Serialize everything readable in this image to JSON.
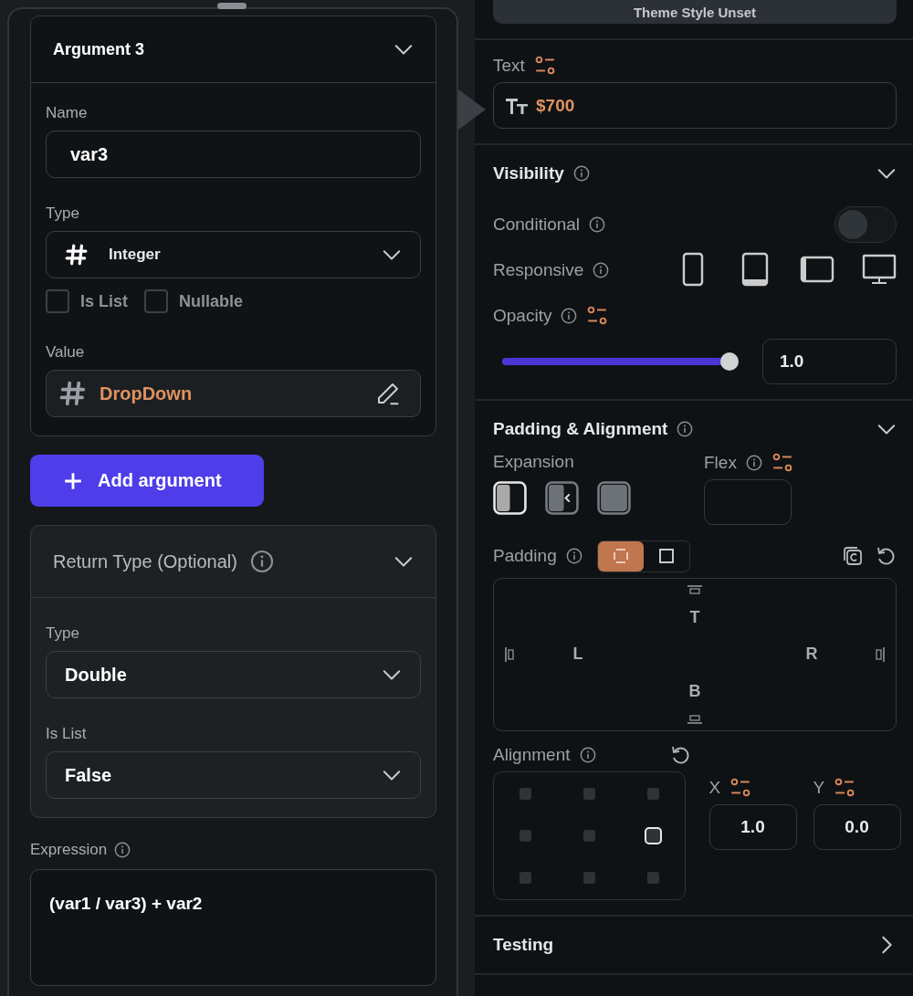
{
  "argument": {
    "title": "Argument 3",
    "expanded": true,
    "name_label": "Name",
    "name_value": "var3",
    "type_label": "Type",
    "type_value": "Integer",
    "checkboxes": [
      {
        "label": "Is List",
        "checked": false
      },
      {
        "label": "Nullable",
        "checked": false
      }
    ],
    "value_label": "Value",
    "value": "DropDown"
  },
  "add_button": {
    "label": "Add argument"
  },
  "return_type": {
    "title": "Return Type (Optional)",
    "expanded": true,
    "fields": [
      {
        "label": "Type",
        "value": "Double"
      },
      {
        "label": "Is List",
        "value": "False"
      }
    ]
  },
  "expression": {
    "label": "Expression",
    "value": "(var1 / var3) + var2"
  },
  "properties": {
    "theme_button": "Theme Style Unset",
    "text": {
      "label": "Text",
      "value": "$700"
    },
    "visibility": {
      "title": "Visibility",
      "expanded": true,
      "conditional_label": "Conditional",
      "conditional_on": false,
      "responsive_label": "Responsive",
      "devices": [
        {
          "kind": "phone"
        },
        {
          "kind": "tablet"
        },
        {
          "kind": "tablet-landscape"
        },
        {
          "kind": "desktop"
        }
      ],
      "opacity": {
        "label": "Opacity",
        "level": 1.0,
        "value": "1.0"
      }
    },
    "padding_alignment": {
      "title": "Padding & Alignment",
      "expanded": true,
      "expansion_label": "Expansion",
      "expansion_options": [
        {
          "kind": "left",
          "selected": true
        },
        {
          "kind": "shrink",
          "selected": false
        },
        {
          "kind": "fill",
          "selected": false
        }
      ],
      "flex_label": "Flex",
      "padding_label": "Padding",
      "padding_modes": [
        {
          "kind": "each",
          "selected": true
        },
        {
          "kind": "all",
          "selected": false
        }
      ],
      "sides": {
        "top": "T",
        "left": "L",
        "right": "R",
        "bottom": "B"
      },
      "alignment_label": "Alignment",
      "alignment_cells": [
        {
          "selected": false
        },
        {
          "selected": false
        },
        {
          "selected": false
        },
        {
          "selected": false
        },
        {
          "selected": false
        },
        {
          "selected": true
        },
        {
          "selected": false
        },
        {
          "selected": false
        },
        {
          "selected": false
        }
      ],
      "x_label": "X",
      "x_value": "1.0",
      "y_label": "Y",
      "y_value": "0.0"
    },
    "testing": {
      "title": "Testing",
      "expanded": false
    }
  }
}
